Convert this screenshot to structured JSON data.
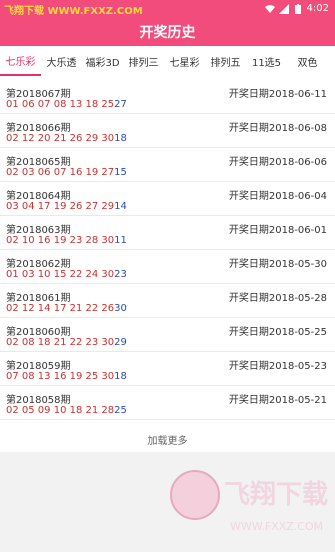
{
  "status": {
    "left_text": "飞翔下载 WWW.FXXZ.COM",
    "time": "4:02"
  },
  "appbar": {
    "title": "开奖历史"
  },
  "tabs": [
    "七乐彩",
    "大乐透",
    "福彩3D",
    "排列三",
    "七星彩",
    "排列五",
    "11选5",
    "双色"
  ],
  "active_tab": "七乐彩",
  "rows": [
    {
      "period": "第2018067期",
      "date": "开奖日期2018-06-11",
      "reds": "01 06 07 08 13 18 25",
      "blue": "27"
    },
    {
      "period": "第2018066期",
      "date": "开奖日期2018-06-08",
      "reds": "02 12 20 21 26 29 30",
      "blue": "18"
    },
    {
      "period": "第2018065期",
      "date": "开奖日期2018-06-06",
      "reds": "02 03 06 07 16 19 27",
      "blue": "15"
    },
    {
      "period": "第2018064期",
      "date": "开奖日期2018-06-04",
      "reds": "03 04 17 19 26 27 29",
      "blue": "14"
    },
    {
      "period": "第2018063期",
      "date": "开奖日期2018-06-01",
      "reds": "02 10 16 19 23 28 30",
      "blue": "11"
    },
    {
      "period": "第2018062期",
      "date": "开奖日期2018-05-30",
      "reds": "01 03 10 15 22 24 30",
      "blue": "23"
    },
    {
      "period": "第2018061期",
      "date": "开奖日期2018-05-28",
      "reds": "02 12 14 17 21 22 26",
      "blue": "30"
    },
    {
      "period": "第2018060期",
      "date": "开奖日期2018-05-25",
      "reds": "02 08 18 21 22 23 30",
      "blue": "29"
    },
    {
      "period": "第2018059期",
      "date": "开奖日期2018-05-23",
      "reds": "07 08 13 16 19 25 30",
      "blue": "18"
    },
    {
      "period": "第2018058期",
      "date": "开奖日期2018-05-21",
      "reds": "02 05 09 10 18 21 28",
      "blue": "25"
    }
  ],
  "load_more": "加载更多",
  "watermark": {
    "text": "飞翔下载",
    "url": "WWW.FXXZ.COM"
  },
  "colors": {
    "brand": "#f24c7c",
    "red": "#c73232",
    "blue": "#2a4db4"
  }
}
